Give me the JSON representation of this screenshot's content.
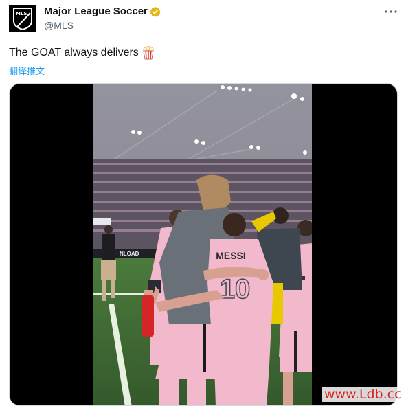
{
  "tweet": {
    "display_name": "Major League Soccer",
    "handle": "@MLS",
    "verified_icon": "verified-badge-gold",
    "text": "The GOAT always delivers",
    "text_emoji": "popcorn",
    "translate_link": "翻译推文"
  },
  "avatar": {
    "logo_text": "MLS"
  },
  "media": {
    "stadium_banner": "NLOAD",
    "jersey_name": "MESSI",
    "jersey_number": "10",
    "colors": {
      "kit_pink": "#f2b8cc",
      "pitch_green": "#3f6b33",
      "accent_gold": "#e8a400"
    }
  },
  "watermark": "www.Ldb.cc"
}
